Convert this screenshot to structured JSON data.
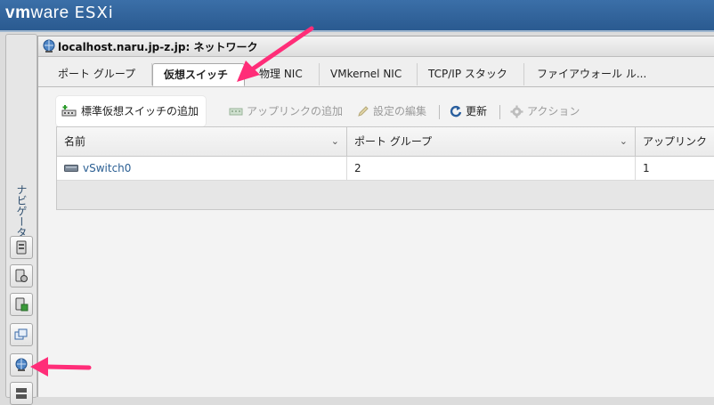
{
  "header": {
    "brand_vm": "vm",
    "brand_ware": "ware",
    "product": "ESXi",
    "color": "#2f639b"
  },
  "navigator": {
    "label": "ナビゲータ",
    "icons": [
      "host-icon",
      "host-manage-icon",
      "host-monitor-icon",
      "virtual-machines-icon",
      "networking-icon",
      "storage-icon"
    ]
  },
  "window": {
    "title": "localhost.naru.jp-z.jp: ネットワーク"
  },
  "tabs": [
    {
      "label": "ポート グループ",
      "active": false
    },
    {
      "label": "仮想スイッチ",
      "active": true
    },
    {
      "label": "物理 NIC",
      "active": false
    },
    {
      "label": "VMkernel NIC",
      "active": false
    },
    {
      "label": "TCP/IP スタック",
      "active": false
    },
    {
      "label": "ファイアウォール ル...",
      "active": false
    }
  ],
  "toolbar": {
    "add_switch": "標準仮想スイッチの追加",
    "add_uplink": "アップリンクの追加",
    "edit_settings": "設定の編集",
    "refresh": "更新",
    "actions": "アクション"
  },
  "table": {
    "columns": [
      "名前",
      "ポート グループ",
      "アップリンク"
    ],
    "rows": [
      {
        "name": "vSwitch0",
        "port_groups": "2",
        "uplinks": "1"
      }
    ]
  },
  "colors": {
    "accent": "#2b5f93",
    "annotation": "#ff2d78"
  }
}
